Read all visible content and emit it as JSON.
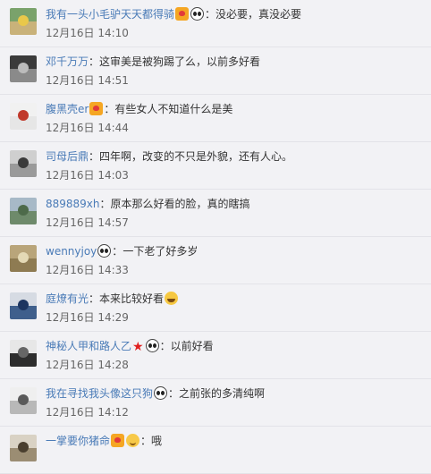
{
  "comments": [
    {
      "user": "我有一头小毛驴天天都得骑",
      "emoji": [
        "vip-icon",
        "panda-icon"
      ],
      "text": "没必要，真没必要",
      "time": "12月16日 14:10",
      "avatar": [
        "#7aa26b",
        "#c9b27a",
        "#e9c84a"
      ]
    },
    {
      "user": "邓千万万",
      "emoji": [],
      "text": "这审美是被狗踢了么，以前多好看",
      "time": "12月16日 14:51",
      "avatar": [
        "#3b3b3b",
        "#8a8a8a",
        "#bcbcbc"
      ]
    },
    {
      "user": "腹黑壳er",
      "emoji": [
        "vip-icon"
      ],
      "text": "有些女人不知道什么是美",
      "time": "12月16日 14:44",
      "avatar": [
        "#f1f1f1",
        "#e6e6e6",
        "#c0392b"
      ]
    },
    {
      "user": "司母后鼎",
      "emoji": [],
      "text": "四年啊，改变的不只是外貌，还有人心。",
      "time": "12月16日 14:03",
      "avatar": [
        "#cfcfcf",
        "#9a9a9a",
        "#3a3a3a"
      ]
    },
    {
      "user": "889889xh",
      "emoji": [],
      "text": "原本那么好看的脸，真的瞎搞",
      "time": "12月16日 14:57",
      "avatar": [
        "#a7b9c7",
        "#6e8a6b",
        "#4d6a4a"
      ]
    },
    {
      "user": "wennyjoy",
      "emoji": [
        "panda-icon"
      ],
      "text": "一下老了好多岁",
      "time": "12月16日 14:33",
      "avatar": [
        "#b9a57a",
        "#8e7b52",
        "#e4d9b5"
      ]
    },
    {
      "user": "庭燎有光",
      "emoji": [],
      "text": "本来比较好看",
      "time": "12月16日 14:29",
      "avatar": [
        "#d6dbe3",
        "#3f5f8c",
        "#1c3560"
      ],
      "trail_emoji": [
        "laugh-icon"
      ]
    },
    {
      "user": "神秘人甲和路人乙",
      "emoji": [
        "star-icon",
        "panda-icon"
      ],
      "text": "以前好看",
      "time": "12月16日 14:28",
      "avatar": [
        "#e7e7e7",
        "#2d2d2d",
        "#666666"
      ]
    },
    {
      "user": "我在寻找我头像这只狗",
      "emoji": [
        "panda-icon"
      ],
      "text": "之前张的多清纯啊",
      "time": "12月16日 14:12",
      "avatar": [
        "#efefef",
        "#b8b8b8",
        "#5a5a5a"
      ]
    },
    {
      "user": "一掌要你猪命",
      "emoji": [
        "vip-icon",
        "smile-icon"
      ],
      "text": "哦",
      "time": "",
      "avatar": [
        "#d9d2c4",
        "#9b8d73",
        "#4a3f2f"
      ]
    }
  ],
  "separator": "："
}
